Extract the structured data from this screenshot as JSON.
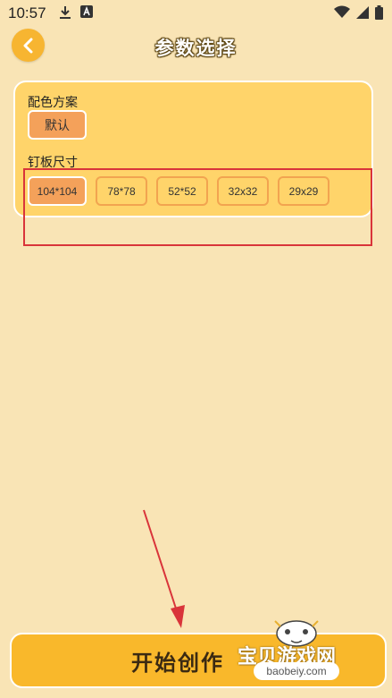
{
  "status_bar": {
    "time": "10:57"
  },
  "header": {
    "title": "参数选择"
  },
  "color_scheme": {
    "label": "配色方案",
    "options": [
      {
        "label": "默认",
        "selected": true
      }
    ]
  },
  "board_size": {
    "label": "钉板尺寸",
    "options": [
      {
        "label": "104*104",
        "selected": true
      },
      {
        "label": "78*78",
        "selected": false
      },
      {
        "label": "52*52",
        "selected": false
      },
      {
        "label": "32x32",
        "selected": false
      },
      {
        "label": "29x29",
        "selected": false
      }
    ]
  },
  "start_button": {
    "label": "开始创作"
  },
  "watermark": {
    "title": "宝贝游戏网",
    "url": "baobeiy.com"
  },
  "colors": {
    "background": "#F9E4B5",
    "accent": "#F7B531",
    "card": "#FFD46A",
    "selected": "#F4A15A",
    "annotation": "#D9343A"
  }
}
